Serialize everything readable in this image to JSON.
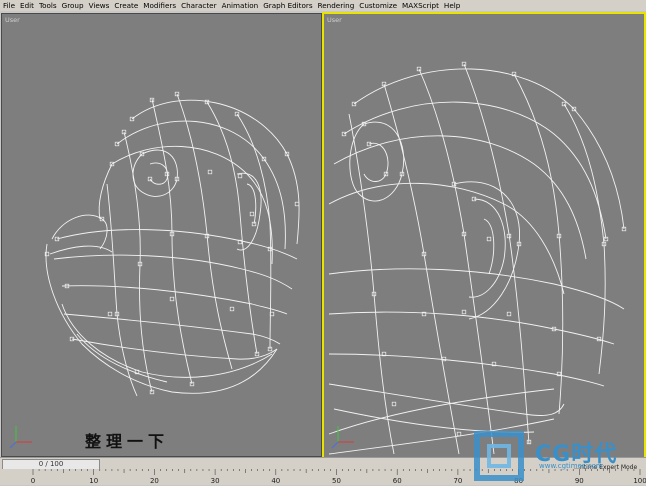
{
  "menu": [
    "File",
    "Edit",
    "Tools",
    "Group",
    "Views",
    "Create",
    "Modifiers",
    "Character",
    "Animation",
    "Graph Editors",
    "Rendering",
    "Customize",
    "MAXScript",
    "Help"
  ],
  "viewports": {
    "left": {
      "label": "User"
    },
    "right": {
      "label": "User"
    }
  },
  "caption": "整理一下",
  "time_slider": {
    "label": "0 / 100"
  },
  "ruler": {
    "ticks": [
      "0",
      "10",
      "20",
      "30",
      "40",
      "50",
      "60",
      "70",
      "80",
      "90",
      "100"
    ]
  },
  "status_right": "…ntime Expert Mode",
  "watermark": {
    "text": "CG时代",
    "url": "www.cgtimes.com"
  },
  "colors": {
    "viewport_bg": "#7e7e7e",
    "active_border": "#e8e400",
    "wire": "#f2f2f2",
    "watermark": "#3a8fc9"
  }
}
